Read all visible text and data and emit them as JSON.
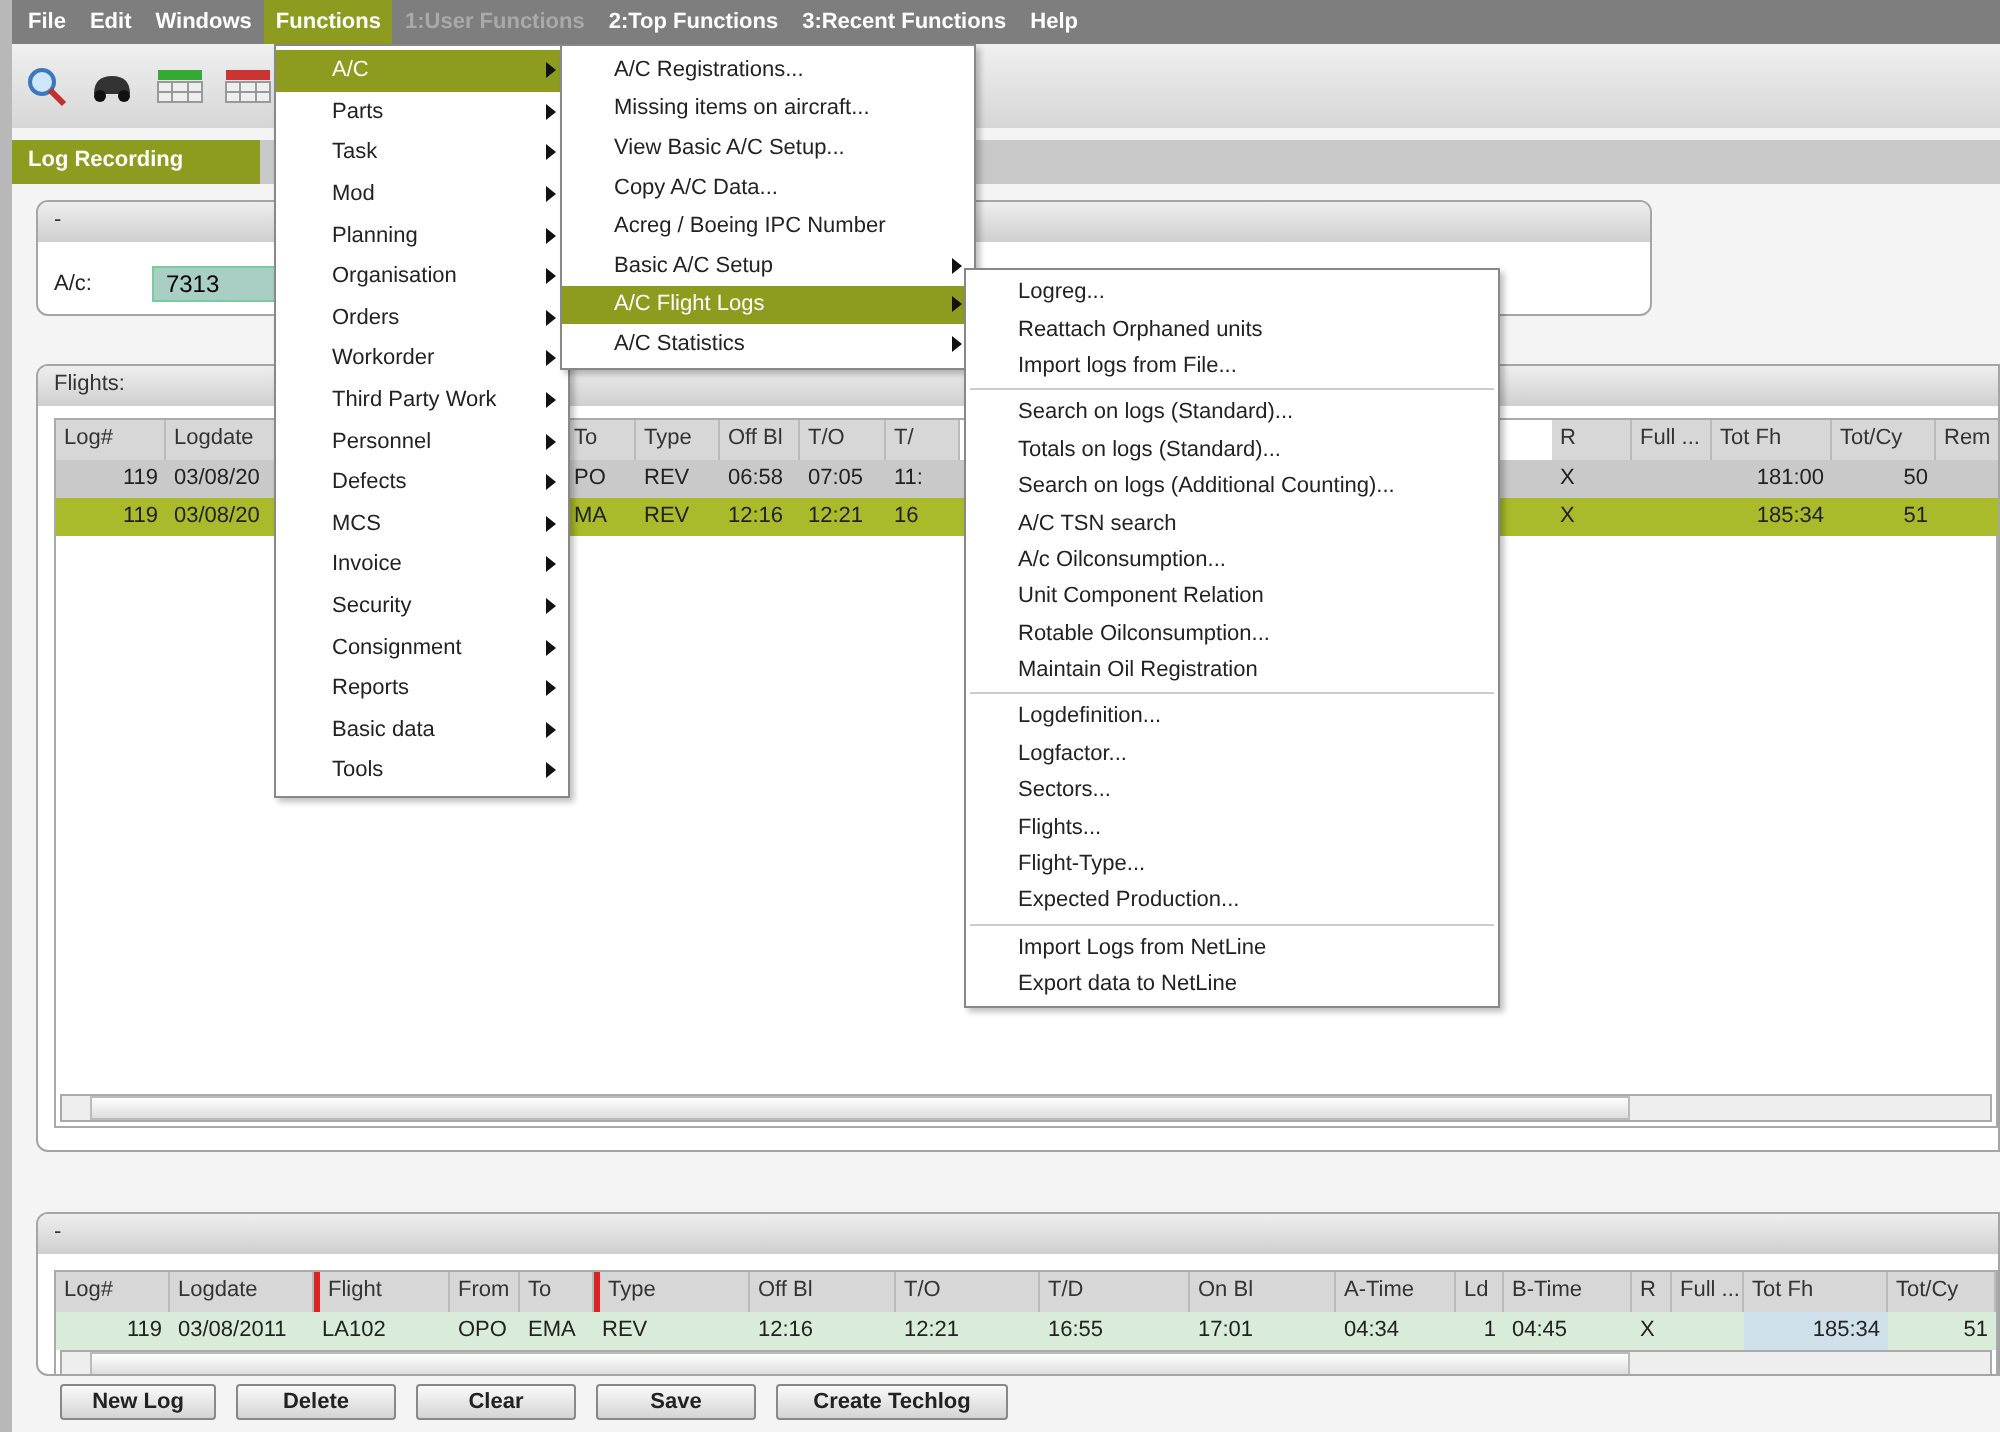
{
  "menu_bar": [
    {
      "label": "File",
      "selected": false,
      "disabled": false
    },
    {
      "label": "Edit",
      "selected": false,
      "disabled": false
    },
    {
      "label": "Windows",
      "selected": false,
      "disabled": false
    },
    {
      "label": "Functions",
      "selected": true,
      "disabled": false
    },
    {
      "label": "1:User Functions",
      "selected": false,
      "disabled": true
    },
    {
      "label": "2:Top Functions",
      "selected": false,
      "disabled": false
    },
    {
      "label": "3:Recent Functions",
      "selected": false,
      "disabled": false
    },
    {
      "label": "Help",
      "selected": false,
      "disabled": false
    }
  ],
  "window_tab": {
    "title": "Log Recording"
  },
  "aircraft_panel": {
    "header": "-",
    "field": {
      "label": "A/c:",
      "value": "7313"
    }
  },
  "flights_panel": {
    "title": "Flights:",
    "columns": [
      "Log#",
      "Logdate",
      "To",
      "Type",
      "Off Bl",
      "T/O",
      "T/",
      "R",
      "Full ...",
      "Tot Fh",
      "Tot/Cy",
      "Rem"
    ],
    "rows": [
      {
        "selected": false,
        "cells": [
          "119",
          "03/08/20",
          "PO",
          "REV",
          "06:58",
          "07:05",
          "11:",
          "X",
          "",
          "181:00",
          "50",
          ""
        ]
      },
      {
        "selected": true,
        "cells": [
          "119",
          "03/08/20",
          "MA",
          "REV",
          "12:16",
          "12:21",
          "16",
          "X",
          "",
          "185:34",
          "51",
          ""
        ]
      }
    ]
  },
  "detail_panel": {
    "header": "-",
    "columns": [
      {
        "label": "Log#",
        "required": false
      },
      {
        "label": "Logdate",
        "required": false
      },
      {
        "label": "Flight",
        "required": true
      },
      {
        "label": "From",
        "required": false
      },
      {
        "label": "To",
        "required": false
      },
      {
        "label": "Type",
        "required": true
      },
      {
        "label": "Off Bl",
        "required": false
      },
      {
        "label": "T/O",
        "required": false
      },
      {
        "label": "T/D",
        "required": false
      },
      {
        "label": "On Bl",
        "required": false
      },
      {
        "label": "A-Time",
        "required": false
      },
      {
        "label": "Ld",
        "required": false
      },
      {
        "label": "B-Time",
        "required": false
      },
      {
        "label": "R",
        "required": false
      },
      {
        "label": "Full ...",
        "required": false
      },
      {
        "label": "Tot Fh",
        "required": false
      },
      {
        "label": "Tot/Cy",
        "required": false
      }
    ],
    "rows": [
      {
        "cells": [
          "119",
          "03/08/2011",
          "LA102",
          "OPO",
          "EMA",
          "REV",
          "12:16",
          "12:21",
          "16:55",
          "17:01",
          "04:34",
          "1",
          "04:45",
          "X",
          "",
          "185:34",
          "51"
        ]
      }
    ]
  },
  "buttons": [
    "New Log",
    "Delete",
    "Clear",
    "Save",
    "Create Techlog"
  ],
  "functions_menu": [
    {
      "label": "A/C",
      "selected": true,
      "has_submenu": true
    },
    {
      "label": "Parts",
      "selected": false,
      "has_submenu": true
    },
    {
      "label": "Task",
      "selected": false,
      "has_submenu": true
    },
    {
      "label": "Mod",
      "selected": false,
      "has_submenu": true
    },
    {
      "label": "Planning",
      "selected": false,
      "has_submenu": true
    },
    {
      "label": "Organisation",
      "selected": false,
      "has_submenu": true
    },
    {
      "label": "Orders",
      "selected": false,
      "has_submenu": true
    },
    {
      "label": "Workorder",
      "selected": false,
      "has_submenu": true
    },
    {
      "label": "Third Party Work",
      "selected": false,
      "has_submenu": true
    },
    {
      "label": "Personnel",
      "selected": false,
      "has_submenu": true
    },
    {
      "label": "Defects",
      "selected": false,
      "has_submenu": true
    },
    {
      "label": "MCS",
      "selected": false,
      "has_submenu": true
    },
    {
      "label": "Invoice",
      "selected": false,
      "has_submenu": true
    },
    {
      "label": "Security",
      "selected": false,
      "has_submenu": true
    },
    {
      "label": "Consignment",
      "selected": false,
      "has_submenu": true
    },
    {
      "label": "Reports",
      "selected": false,
      "has_submenu": true
    },
    {
      "label": "Basic data",
      "selected": false,
      "has_submenu": true
    },
    {
      "label": "Tools",
      "selected": false,
      "has_submenu": true
    }
  ],
  "ac_menu": [
    {
      "label": "A/C Registrations...",
      "selected": false,
      "has_submenu": false
    },
    {
      "label": "Missing items on aircraft...",
      "selected": false,
      "has_submenu": false
    },
    {
      "label": "View Basic A/C Setup...",
      "selected": false,
      "has_submenu": false
    },
    {
      "label": "Copy A/C Data...",
      "selected": false,
      "has_submenu": false
    },
    {
      "label": "Acreg / Boeing IPC Number",
      "selected": false,
      "has_submenu": false
    },
    {
      "label": "Basic A/C Setup",
      "selected": false,
      "has_submenu": true
    },
    {
      "label": "A/C Flight Logs",
      "selected": true,
      "has_submenu": true
    },
    {
      "label": "A/C Statistics",
      "selected": false,
      "has_submenu": true
    }
  ],
  "flight_logs_menu": [
    {
      "items": [
        "Logreg...",
        "Reattach Orphaned units",
        "Import logs from File..."
      ]
    },
    {
      "items": [
        "Search on logs (Standard)...",
        "Totals on logs (Standard)...",
        "Search on logs (Additional Counting)...",
        "A/C TSN search",
        "A/c Oilconsumption...",
        "Unit Component Relation",
        "Rotable Oilconsumption...",
        "Maintain Oil Registration"
      ]
    },
    {
      "items": [
        "Logdefinition...",
        "Logfactor...",
        "Sectors...",
        "Flights...",
        "Flight-Type...",
        "Expected Production..."
      ]
    },
    {
      "items": [
        "Import Logs from NetLine",
        "Export data to NetLine"
      ]
    }
  ]
}
